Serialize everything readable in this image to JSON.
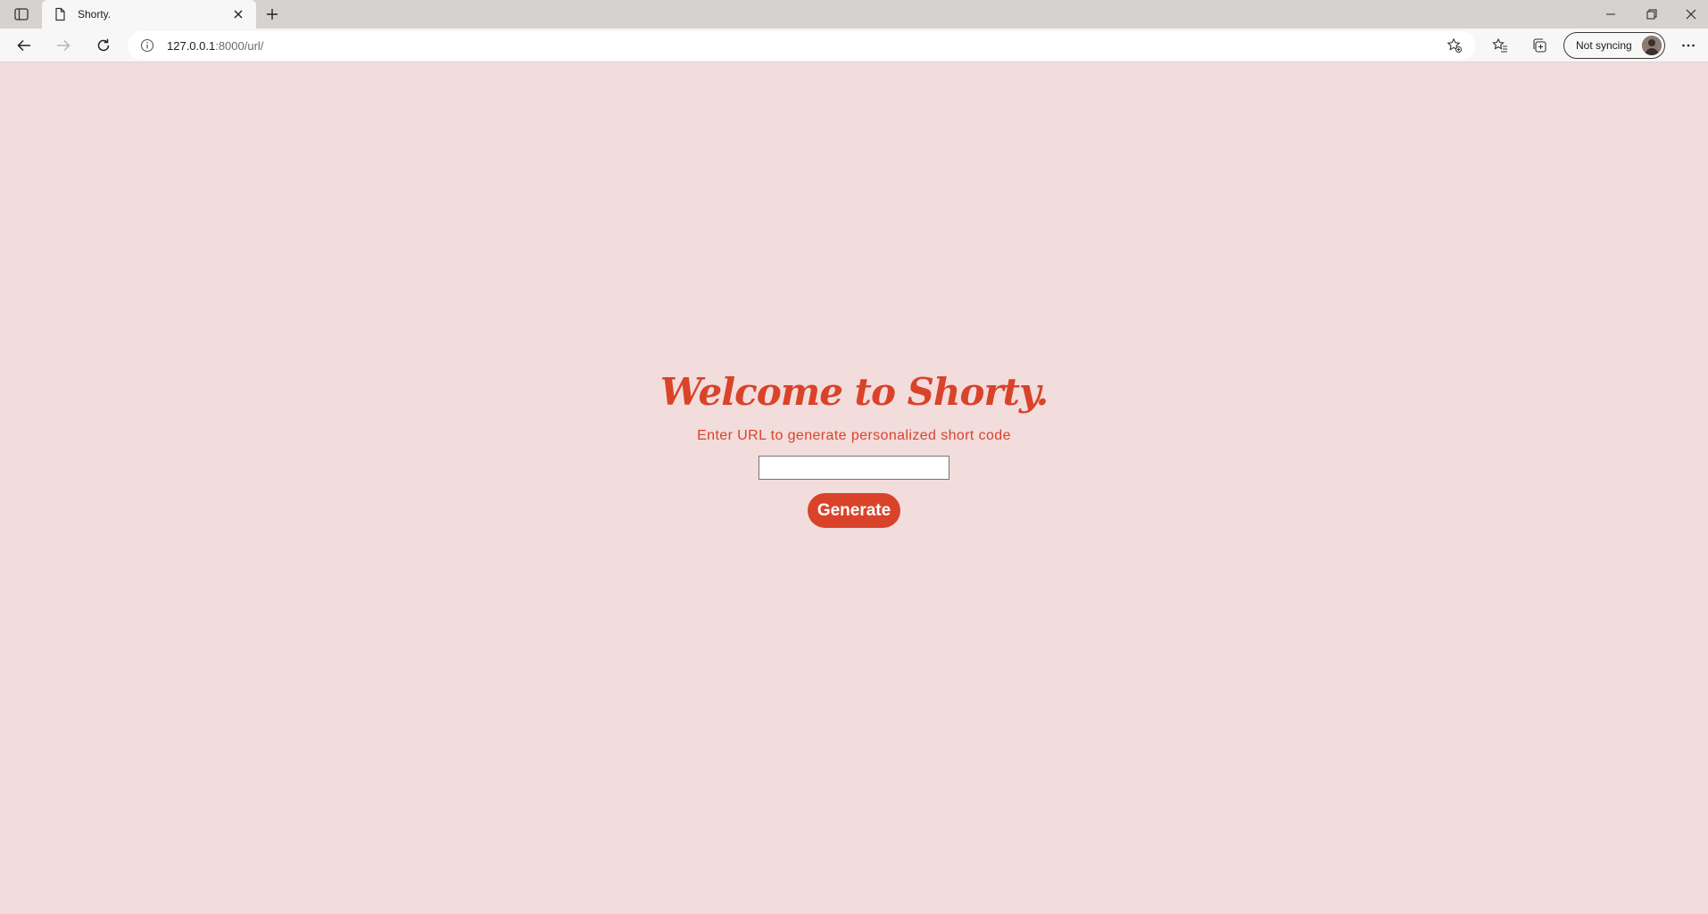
{
  "browser": {
    "tab_title": "Shorty.",
    "url_host": "127.0.0.1",
    "url_path": ":8000/url/",
    "profile_label": "Not syncing"
  },
  "icons": {
    "tab_actions": "tab-actions-icon",
    "favicon": "page-icon",
    "tab_close": "close-icon",
    "new_tab": "plus-icon",
    "minimize": "minimize-icon",
    "restore": "restore-icon",
    "window_close": "close-icon",
    "back": "back-arrow-icon",
    "forward": "forward-arrow-icon",
    "refresh": "refresh-icon",
    "site_info": "info-icon",
    "add_favorite": "star-add-icon",
    "favorites": "favorites-icon",
    "collections": "collections-icon",
    "more": "more-icon"
  },
  "page": {
    "heading": "Welcome to Shorty.",
    "subtitle": "Enter URL to generate personalized short code",
    "url_input_value": "",
    "generate_label": "Generate"
  },
  "colors": {
    "accent": "#d9432a",
    "page_background": "#f2dcdc"
  }
}
